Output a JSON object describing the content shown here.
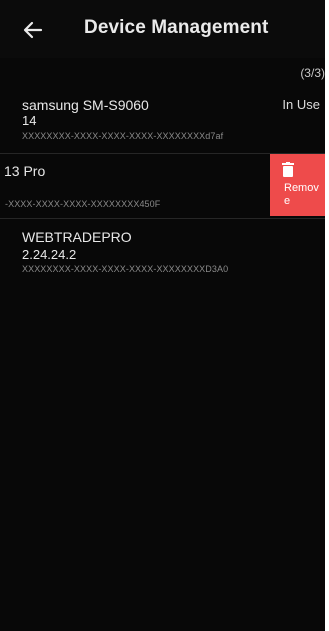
{
  "header": {
    "title": "Device Management",
    "back_icon": "arrow-left-icon"
  },
  "device_count": "(3/3)",
  "devices": [
    {
      "name": "samsung SM-S9060",
      "version": "14",
      "id": "XXXXXXXX-XXXX-XXXX-XXXX-XXXXXXXXd7af",
      "status": "In Use"
    },
    {
      "name": "13 Pro",
      "version": "",
      "id": "-XXXX-XXXX-XXXX-XXXXXXXX450F",
      "status": ""
    },
    {
      "name": "WEBTRADEPRO",
      "version": "2.24.24.2",
      "id": "XXXXXXXX-XXXX-XXXX-XXXX-XXXXXXXXD3A0",
      "status": ""
    }
  ],
  "remove_action": {
    "label": "Remove",
    "icon": "trash-icon",
    "color": "#ee4b4b"
  },
  "colors": {
    "background": "#080808",
    "text": "#e8e8e8",
    "muted": "#8a8a8a"
  }
}
